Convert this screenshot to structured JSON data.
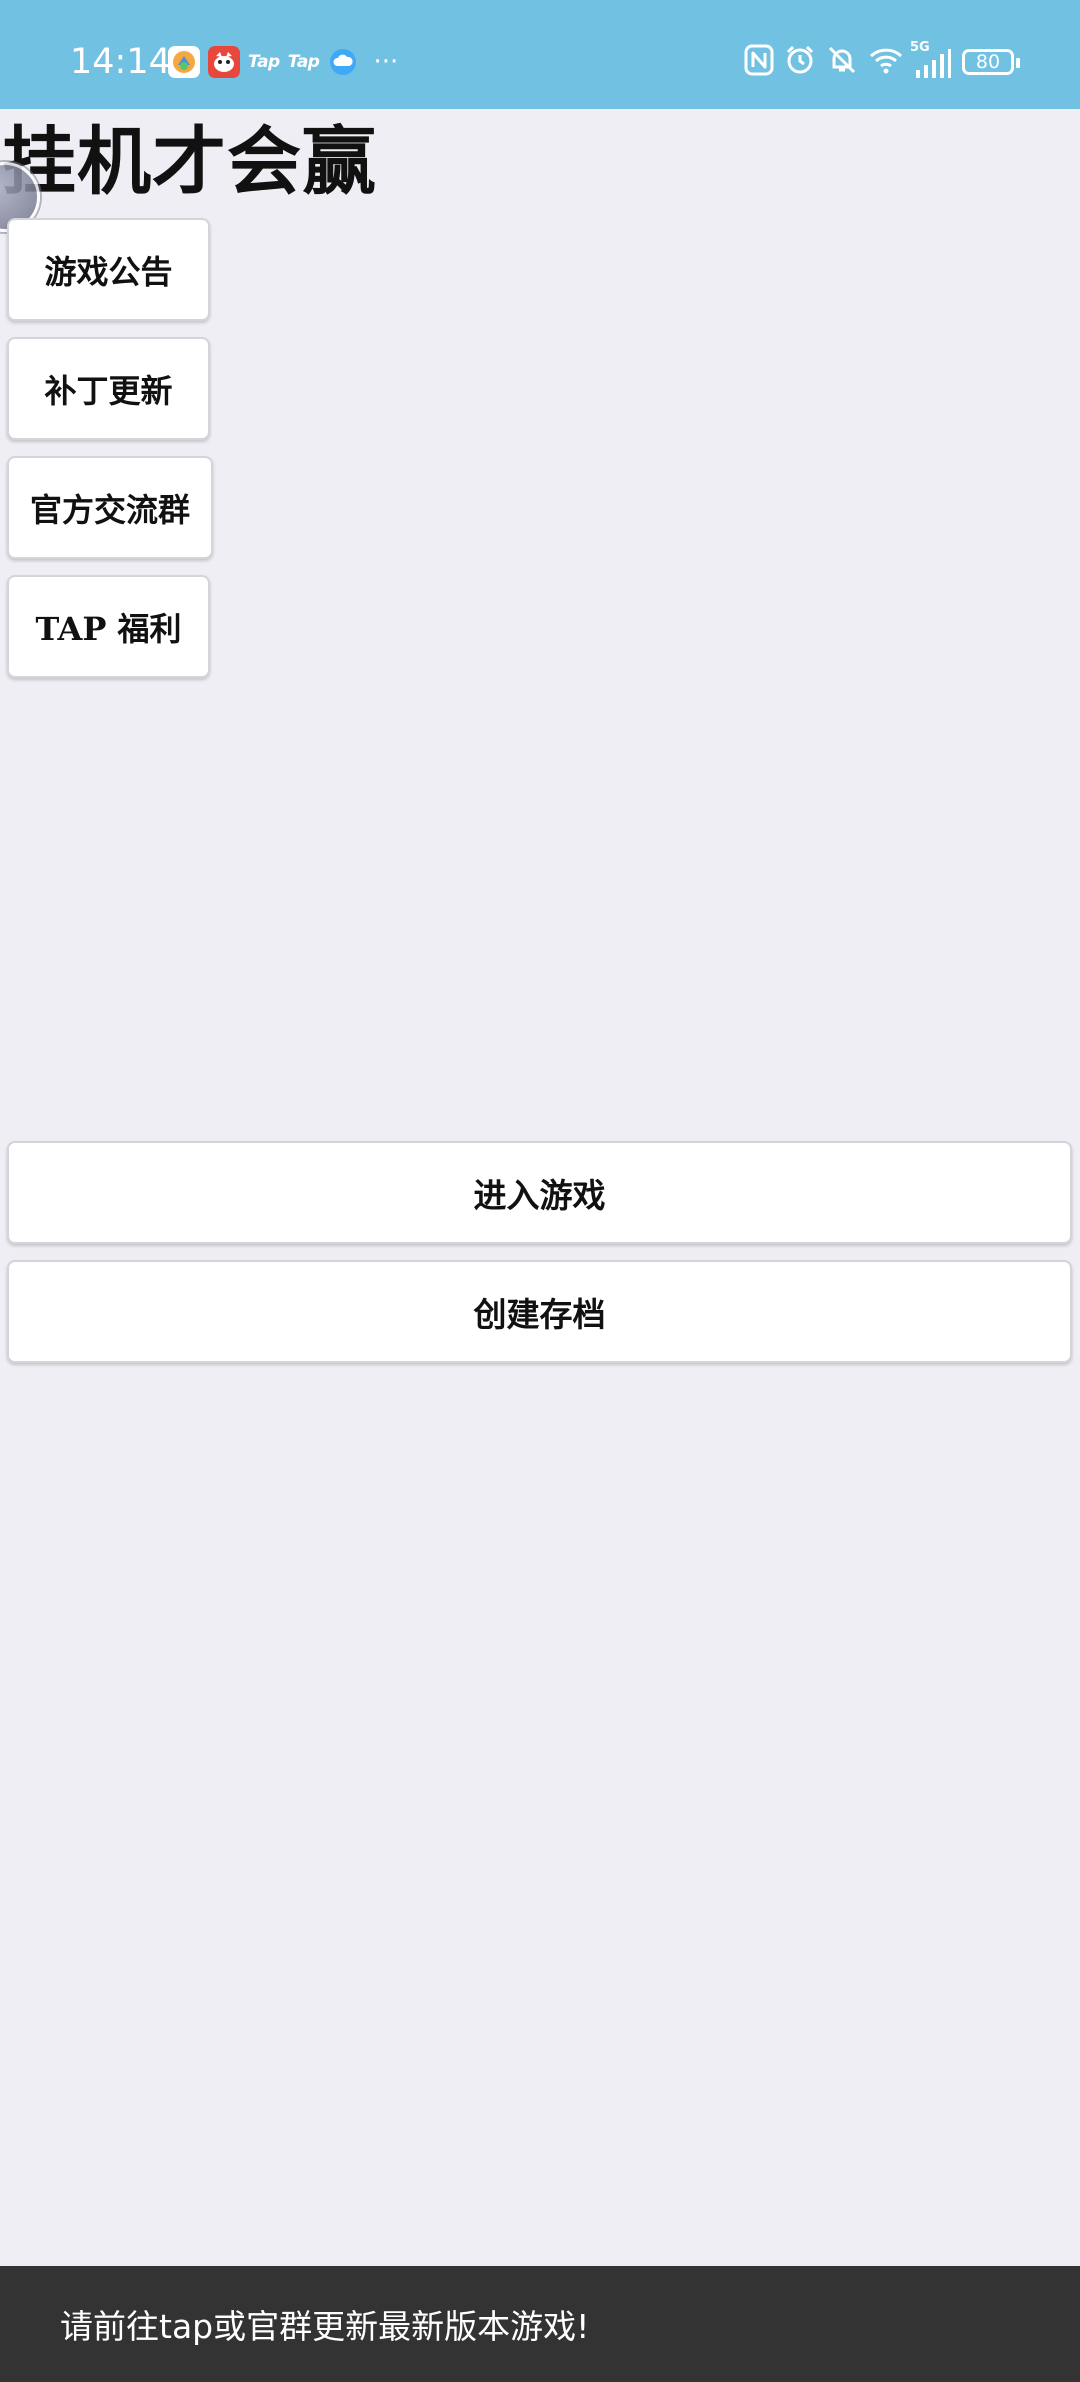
{
  "status_bar": {
    "time": "14:14",
    "notifications": [
      {
        "icon": "document-app-icon"
      },
      {
        "icon": "jd-app-icon"
      },
      {
        "label": "Tap"
      },
      {
        "label": "Tap"
      },
      {
        "icon": "cloud-icon"
      }
    ],
    "more": "···",
    "system_icons": [
      "nfc-icon",
      "alarm-icon",
      "mute-bell-icon",
      "wifi-icon",
      "signal-5g-icon"
    ],
    "signal_label": "5G",
    "battery_level": "80"
  },
  "game": {
    "title": "挂机才会赢"
  },
  "side_menu": [
    {
      "label": "游戏公告"
    },
    {
      "label": "补丁更新"
    },
    {
      "label": "官方交流群"
    },
    {
      "label": "TAP 福利"
    }
  ],
  "actions": {
    "enter_game": "进入游戏",
    "create_save": "创建存档"
  },
  "toast": {
    "message": "请前往tap或官群更新最新版本游戏!"
  },
  "colors": {
    "status_bar": "#70c1e2",
    "background": "#efeef4",
    "toast": "#333333",
    "button": "#ffffff"
  }
}
